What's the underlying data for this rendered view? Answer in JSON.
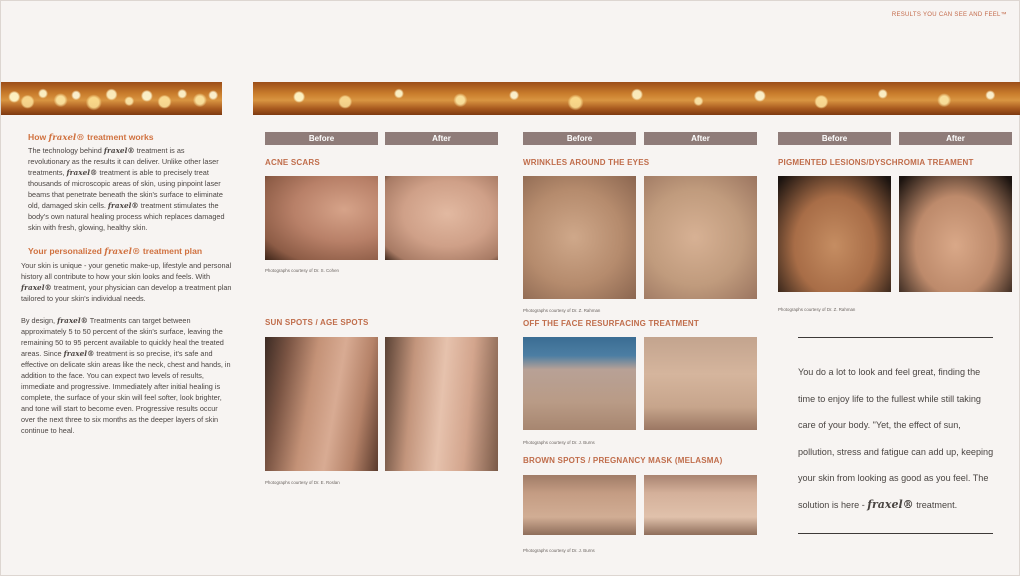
{
  "header": {
    "tagline": "RESULTS YOU CAN SEE AND FEEL™"
  },
  "brand": {
    "name": "fraxel",
    "name_reg": "fraxel®"
  },
  "left": {
    "how_title_pre": "How",
    "how_title_post": "treatment works",
    "how_p1": "The technology behind",
    "how_p1b": "treatment is as revolutionary as the results it can deliver. Unlike other laser treatments,",
    "how_p1c": "treatment is able to precisely treat thousands of microscopic areas of skin, using pinpoint laser beams that penetrate beneath the skin's surface to eliminate old, damaged skin cells.",
    "how_p1d": "treatment stimulates the body's own natural healing process which replaces damaged skin with fresh, glowing, healthy skin.",
    "plan_title_pre": "Your personalized",
    "plan_title_post": "treatment plan",
    "plan_p1": "Your skin is unique - your genetic make-up, lifestyle and personal history all contribute to how your skin looks and feels. With",
    "plan_p1b": "treatment, your physician can develop a treatment plan tailored to your skin's individual needs.",
    "design_p_pre": "By design,",
    "design_p_a": "Treatments can target between approximately 5 to 50 percent of the skin's surface, leaving the remaining 50 to 95 percent available to quickly heal the treated areas. Since",
    "design_p_b": "treatment is so precise, it's safe and effective on delicate skin areas like the neck, chest and hands, in addition to the face. You can expect two levels of results, immediate and progressive. Immediately after initial healing is complete, the surface of your skin will feel softer, look brighter, and tone will start to become even. Progressive results occur over the next three to six months as the deeper layers of skin continue to heal."
  },
  "labels": {
    "before": "Before",
    "after": "After"
  },
  "sections": {
    "acne": {
      "title": "ACNE SCARS",
      "credit": "Photographs courtesy of Dr. S. Cohen"
    },
    "sun": {
      "title": "SUN SPOTS / AGE SPOTS",
      "credit": "Photographs courtesy of Dr. E. Roslan"
    },
    "wrinkles": {
      "title": "WRINKLES AROUND THE EYES",
      "credit": "Photographs courtesy of Dr. Z. Rahman"
    },
    "offface": {
      "title": "OFF THE FACE RESURFACING TREATMENT",
      "credit": "Photographs courtesy of Dr. J. Burns"
    },
    "brown": {
      "title": "BROWN SPOTS / PREGNANCY MASK (MELASMA)",
      "credit": "Photographs courtesy of Dr. J. Burns"
    },
    "pigment": {
      "title": "PIGMENTED LESIONS/DYSCHROMIA TREAMENT",
      "credit": "Photographs courtesy of Dr. Z. Rahman"
    }
  },
  "quote": {
    "text": "You do a lot to look and feel great, finding the time to enjoy life to the fullest while still taking care of your body. \"Yet, the effect of sun, pollution, stress and fatigue can add up, keeping your skin from looking as good as you feel. The solution is here -",
    "tail": "treatment."
  }
}
